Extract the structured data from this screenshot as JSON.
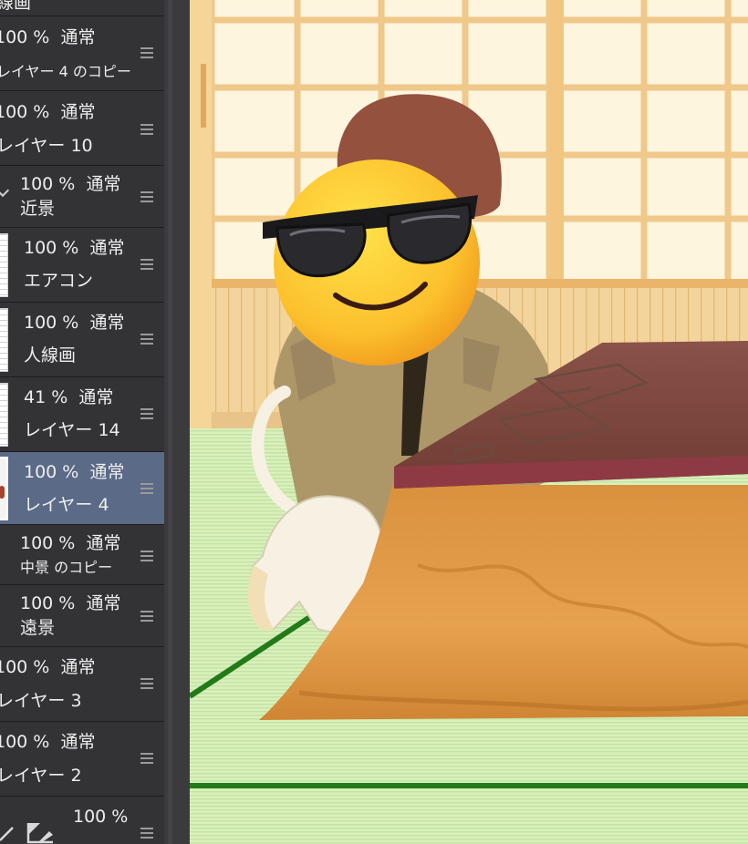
{
  "layers": [
    {
      "opacity": "",
      "blend": "",
      "name": "線画",
      "type": "partial"
    },
    {
      "opacity": "100 %",
      "blend": "通常",
      "name": "レイヤー 4 のコピー",
      "type": "layer"
    },
    {
      "opacity": "100 %",
      "blend": "通常",
      "name": "レイヤー 10",
      "type": "layer"
    },
    {
      "opacity": "100 %",
      "blend": "通常",
      "name": "近景",
      "type": "folder"
    },
    {
      "opacity": "100 %",
      "blend": "通常",
      "name": "エアコン",
      "type": "layer-thumb"
    },
    {
      "opacity": "100 %",
      "blend": "通常",
      "name": "人線画",
      "type": "layer-thumb"
    },
    {
      "opacity": "41 %",
      "blend": "通常",
      "name": "レイヤー 14",
      "type": "layer-thumb"
    },
    {
      "opacity": "100 %",
      "blend": "通常",
      "name": "レイヤー 4",
      "type": "layer-thumb",
      "selected": true
    },
    {
      "opacity": "100 %",
      "blend": "通常",
      "name": "中景 のコピー",
      "type": "folder"
    },
    {
      "opacity": "100 %",
      "blend": "通常",
      "name": "遠景",
      "type": "folder"
    },
    {
      "opacity": "100 %",
      "blend": "通常",
      "name": "レイヤー 3",
      "type": "layer"
    },
    {
      "opacity": "100 %",
      "blend": "通常",
      "name": "レイヤー 2",
      "type": "layer"
    },
    {
      "opacity": "100 %",
      "blend": "",
      "name": "",
      "type": "bottom"
    }
  ],
  "icons": {
    "drag_handle": "drag-handle-icon",
    "folder": "folder-expand-icon",
    "pen": "pen-icon",
    "clipping": "clipping-icon"
  },
  "colors": {
    "panel_bg": "#333336",
    "selected_row": "#5b6a87",
    "text": "#eeeeee"
  }
}
